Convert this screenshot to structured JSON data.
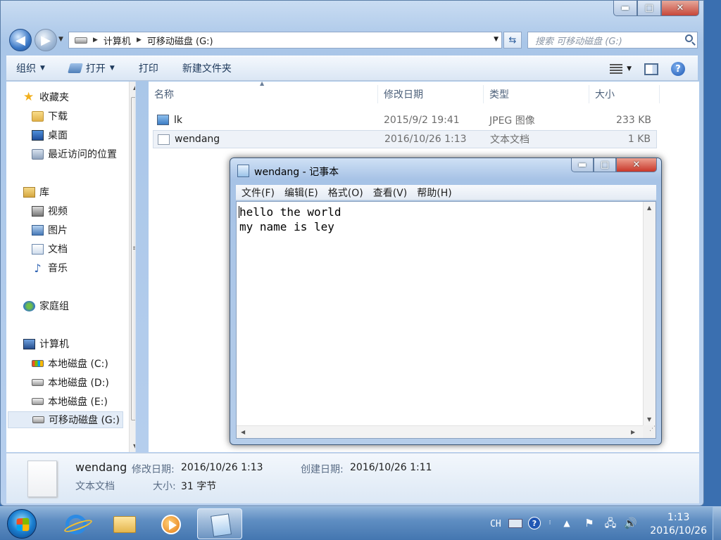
{
  "explorer": {
    "caption_buttons": {
      "minimize": "▬",
      "maximize": "□",
      "close": "✕"
    },
    "address": {
      "crumbs": [
        "计算机",
        "可移动磁盘 (G:)"
      ]
    },
    "search_placeholder": "搜索 可移动磁盘 (G:)",
    "toolbar": {
      "organize": "组织",
      "open": "打开",
      "print": "打印",
      "new_folder": "新建文件夹"
    },
    "nav": {
      "favorites": "收藏夹",
      "favorites_items": [
        "下载",
        "桌面",
        "最近访问的位置"
      ],
      "libraries": "库",
      "library_items": [
        "视频",
        "图片",
        "文档",
        "音乐"
      ],
      "homegroup": "家庭组",
      "computer": "计算机",
      "drives": [
        "本地磁盘 (C:)",
        "本地磁盘 (D:)",
        "本地磁盘 (E:)",
        "可移动磁盘 (G:)"
      ],
      "selected": "可移动磁盘 (G:)"
    },
    "columns": [
      "名称",
      "修改日期",
      "类型",
      "大小"
    ],
    "files": [
      {
        "name": "lk",
        "modified": "2015/9/2 19:41",
        "type": "JPEG 图像",
        "size": "233 KB",
        "icon": "jpeg-image-icon"
      },
      {
        "name": "wendang",
        "modified": "2016/10/26 1:13",
        "type": "文本文档",
        "size": "1 KB",
        "icon": "text-document-icon",
        "selected": true
      }
    ],
    "details": {
      "name": "wendang",
      "type": "文本文档",
      "modified_label": "修改日期:",
      "modified_value": "2016/10/26 1:13",
      "created_label": "创建日期:",
      "created_value": "2016/10/26 1:11",
      "size_label": "大小:",
      "size_value": "31 字节"
    }
  },
  "notepad": {
    "title": "wendang - 记事本",
    "menu": [
      "文件(F)",
      "编辑(E)",
      "格式(O)",
      "查看(V)",
      "帮助(H)"
    ],
    "content": "hello the world\nmy name is ley"
  },
  "taskbar": {
    "language": "CH",
    "time": "1:13",
    "date": "2016/10/26",
    "pinned": [
      "internet-explorer-icon",
      "windows-explorer-icon",
      "media-player-icon",
      "notepad-icon"
    ],
    "active": "notepad-icon"
  }
}
